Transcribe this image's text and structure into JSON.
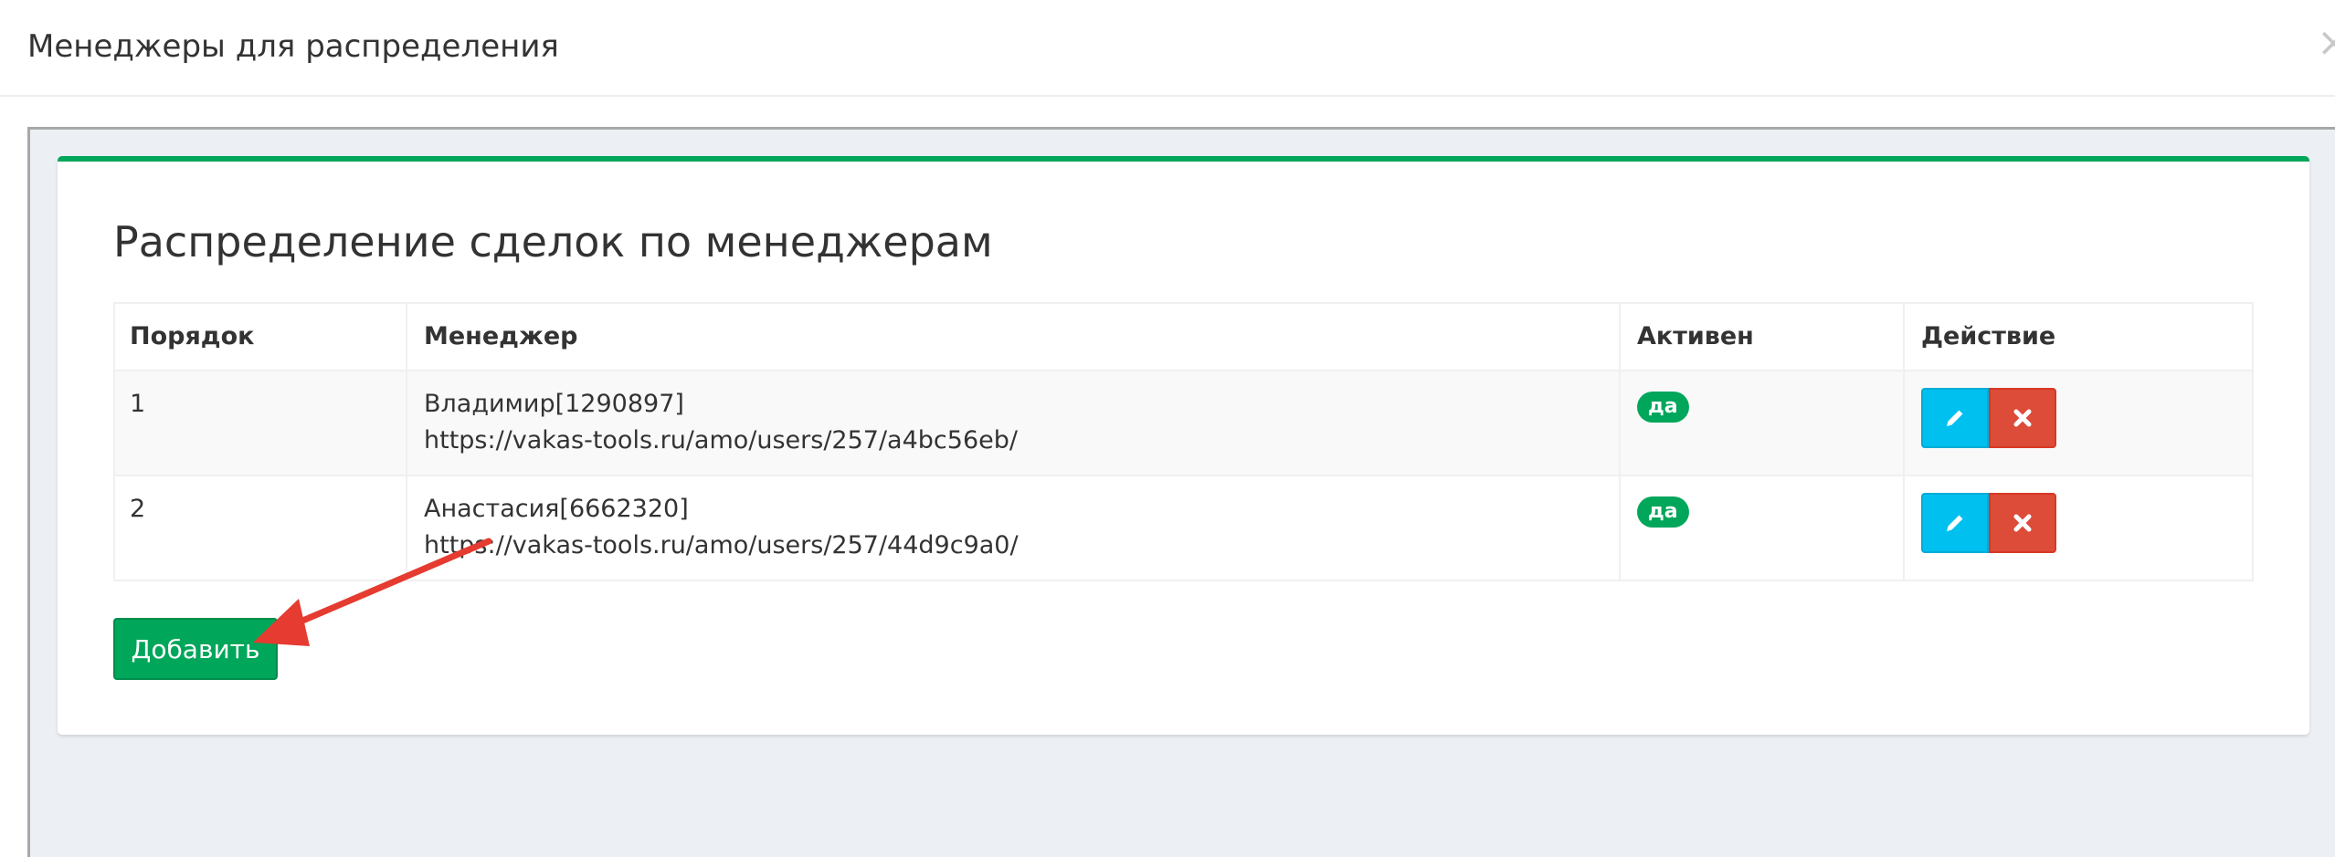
{
  "modal": {
    "title": "Менеджеры для распределения",
    "close_symbol": "×"
  },
  "panel": {
    "title": "Распределение сделок по менеджерам",
    "accent_color": "#00a65a"
  },
  "table": {
    "headers": [
      "Порядок",
      "Менеджер",
      "Активен",
      "Действие"
    ],
    "rows": [
      {
        "order": "1",
        "manager_name": "Владимир[1290897]",
        "manager_url": "https://vakas-tools.ru/amo/users/257/a4bc56eb/",
        "active": "да"
      },
      {
        "order": "2",
        "manager_name": "Анастасия[6662320]",
        "manager_url": "https://vakas-tools.ru/amo/users/257/44d9c9a0/",
        "active": "да"
      }
    ],
    "actions": {
      "edit_icon": "pencil-icon",
      "delete_icon": "times-icon",
      "edit_color": "#00c0ef",
      "delete_color": "#dd4b39"
    }
  },
  "add_button": {
    "label": "Добавить"
  },
  "annotation": {
    "arrow_color": "#e53b30"
  }
}
